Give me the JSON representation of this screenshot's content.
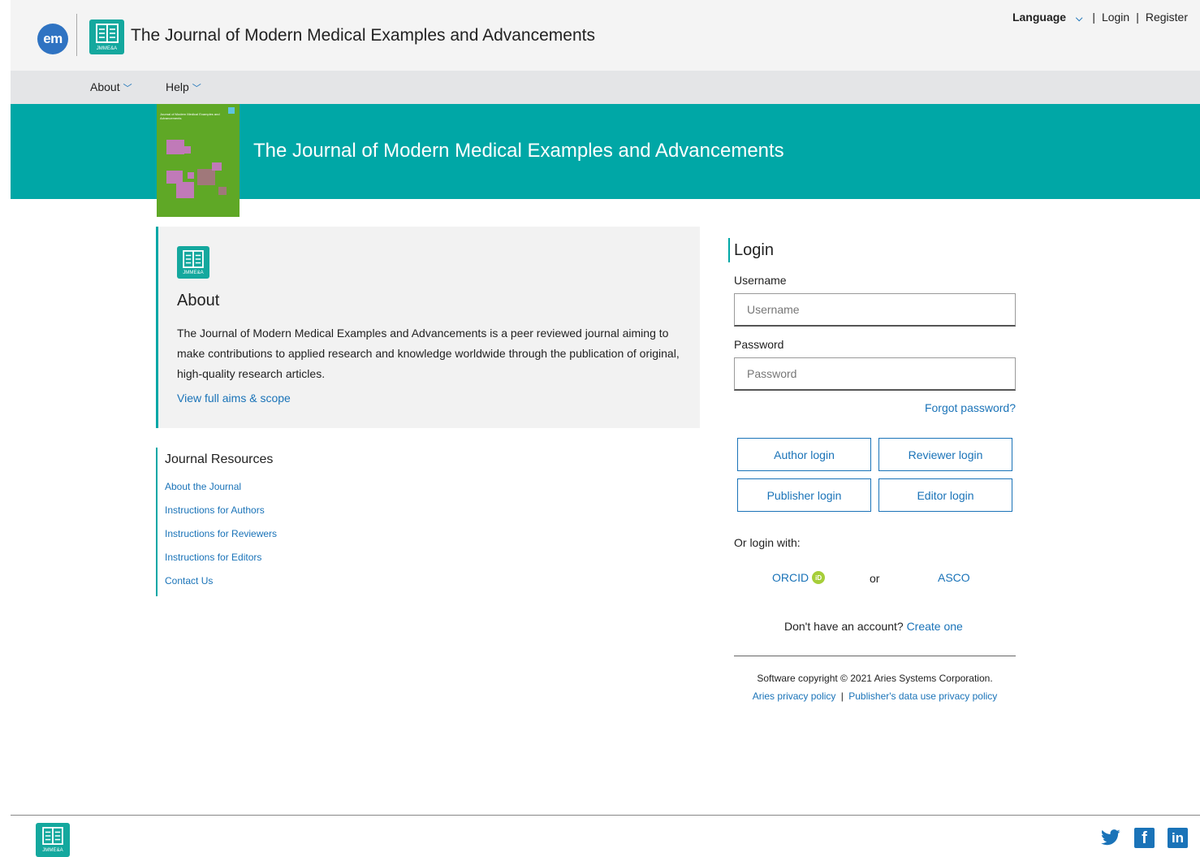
{
  "header": {
    "em_logo_text": "em",
    "logo_abbr": "JMME&A",
    "title": "The Journal of Modern Medical Examples and Advancements",
    "language_label": "Language",
    "login_label": "Login",
    "register_label": "Register",
    "separator": "|"
  },
  "nav": {
    "items": [
      {
        "label": "About"
      },
      {
        "label": "Help"
      }
    ]
  },
  "banner": {
    "title": "The Journal of Modern Medical Examples and Advancements",
    "cover_text": "Journal of Modern Medical Examples and Advancements"
  },
  "about": {
    "logo_abbr": "JMME&A",
    "heading": "About",
    "text": "The Journal of Modern Medical Examples and Advancements is a peer reviewed journal aiming to make contributions to applied research and knowledge worldwide through the publication of original, high-quality research articles.",
    "link": "View full aims & scope"
  },
  "resources": {
    "heading": "Journal Resources",
    "items": [
      {
        "label": "About the Journal"
      },
      {
        "label": "Instructions for Authors"
      },
      {
        "label": "Instructions for Reviewers"
      },
      {
        "label": "Instructions for Editors"
      },
      {
        "label": "Contact Us"
      }
    ]
  },
  "login": {
    "heading": "Login",
    "username_label": "Username",
    "username_placeholder": "Username",
    "username_value": "",
    "password_label": "Password",
    "password_placeholder": "Password",
    "password_value": "",
    "forgot": "Forgot password?",
    "buttons": {
      "author": "Author login",
      "reviewer": "Reviewer login",
      "publisher": "Publisher login",
      "editor": "Editor login"
    },
    "or_login_with": "Or login with:",
    "orcid": "ORCID",
    "orcid_badge": "iD",
    "or": "or",
    "asco": "ASCO",
    "no_account": "Don't have an account?",
    "create_one": "Create one",
    "copyright": "Software copyright © 2021 Aries Systems Corporation.",
    "aries_privacy": "Aries privacy policy",
    "publisher_privacy": "Publisher's data use privacy policy",
    "policy_separator": "|"
  },
  "footer": {
    "logo_abbr": "JMME&A",
    "social_icons": [
      "twitter-icon",
      "facebook-icon",
      "linkedin-icon"
    ]
  },
  "colors": {
    "teal": "#00a7a6",
    "link_blue": "#1a73b8",
    "logo_teal": "#14a89e",
    "em_blue": "#2f73c2",
    "cover_green": "#5fa826"
  }
}
